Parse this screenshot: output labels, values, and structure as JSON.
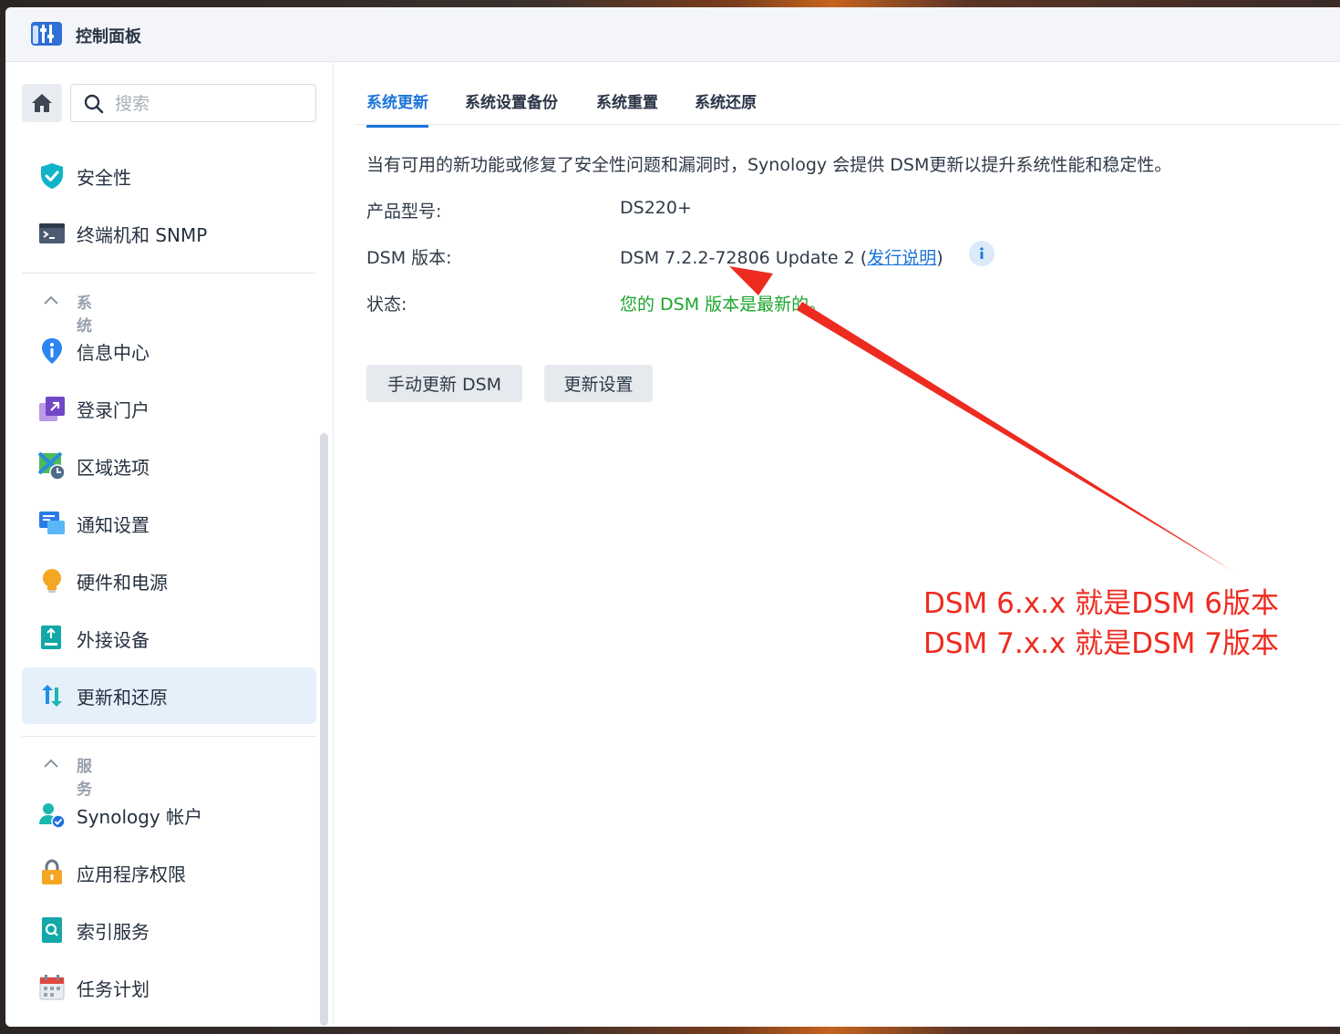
{
  "window": {
    "title": "控制面板"
  },
  "sidebar": {
    "search_placeholder": "搜索",
    "top_items": [
      {
        "label": "安全性",
        "icon": "shield-check-icon"
      },
      {
        "label": "终端机和 SNMP",
        "icon": "terminal-icon"
      }
    ],
    "system_section": {
      "title": "系统",
      "items": [
        {
          "label": "信息中心",
          "icon": "info-pin-icon"
        },
        {
          "label": "登录门户",
          "icon": "login-portal-icon"
        },
        {
          "label": "区域选项",
          "icon": "region-clock-icon"
        },
        {
          "label": "通知设置",
          "icon": "notification-chat-icon"
        },
        {
          "label": "硬件和电源",
          "icon": "lightbulb-icon"
        },
        {
          "label": "外接设备",
          "icon": "external-device-icon"
        },
        {
          "label": "更新和还原",
          "icon": "update-restore-icon",
          "active": true
        }
      ]
    },
    "services_section": {
      "title": "服务",
      "items": [
        {
          "label": "Synology 帐户",
          "icon": "account-user-icon"
        },
        {
          "label": "应用程序权限",
          "icon": "padlock-icon"
        },
        {
          "label": "索引服务",
          "icon": "index-search-icon"
        },
        {
          "label": "任务计划",
          "icon": "calendar-icon"
        }
      ]
    }
  },
  "main": {
    "tabs": [
      {
        "label": "系统更新",
        "active": true
      },
      {
        "label": "系统设置备份"
      },
      {
        "label": "系统重置"
      },
      {
        "label": "系统还原"
      }
    ],
    "intro": "当有可用的新功能或修复了安全性问题和漏洞时，Synology 会提供 DSM更新以提升系统性能和稳定性。",
    "fields": {
      "model_label": "产品型号:",
      "model_value": "DS220+",
      "version_label": "DSM 版本:",
      "version_value": "DSM 7.2.2-72806 Update 2",
      "release_link": "发行说明",
      "status_label": "状态:",
      "status_value": "您的 DSM 版本是最新的。"
    },
    "buttons": {
      "manual_update": "手动更新 DSM",
      "update_settings": "更新设置"
    }
  },
  "annotation": {
    "line1": "DSM 6.x.x 就是DSM 6版本",
    "line2": "DSM 7.x.x 就是DSM 7版本",
    "color": "#ee2b20"
  },
  "colors": {
    "accent": "#1a73d9",
    "status_ok": "#1aa52b",
    "active_bg": "#e6f0fb"
  }
}
